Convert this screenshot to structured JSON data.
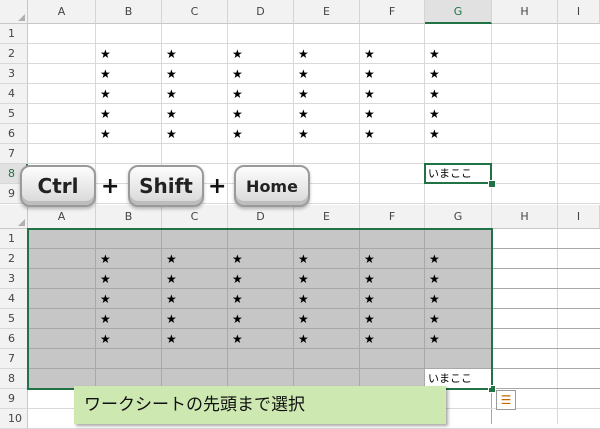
{
  "columns": [
    "A",
    "B",
    "C",
    "D",
    "E",
    "F",
    "G",
    "H",
    "I"
  ],
  "top_sheet": {
    "rows": [
      "1",
      "2",
      "3",
      "4",
      "5",
      "6",
      "7",
      "8",
      "9"
    ],
    "active_column": "G",
    "active_row": "8"
  },
  "bottom_sheet": {
    "rows": [
      "1",
      "2",
      "3",
      "4",
      "5",
      "6",
      "7",
      "8",
      "9",
      "10"
    ],
    "selection": "A1:G8"
  },
  "star_glyph": "★",
  "star_cells": {
    "columns": [
      "B",
      "C",
      "D",
      "E",
      "F",
      "G"
    ],
    "rows": [
      "2",
      "3",
      "4",
      "5",
      "6"
    ]
  },
  "cell_g8_text": "いまここ",
  "shortcut": {
    "keys": [
      "Ctrl",
      "Shift",
      "Home"
    ],
    "separator": "+"
  },
  "caption": "ワークシートの先頭まで選択",
  "icons": {
    "paste_options": "paste-options-icon"
  },
  "colors": {
    "selection_border": "#217346",
    "selection_fill": "#c6c6c6",
    "caption_bg": "#cde8b0"
  }
}
